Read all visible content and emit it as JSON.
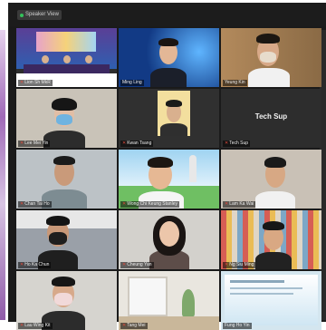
{
  "top_bar": {
    "view_label": "Speaker View"
  },
  "participants": [
    {
      "name": "Lion Sh MkR",
      "bg": "#4a3d7a"
    },
    {
      "name": "Ming Ling",
      "bg": "#163a7a"
    },
    {
      "name": "Yeung Kin",
      "bg": "#8a6a45"
    },
    {
      "name": "Lee Mei Yin",
      "bg": "#c9c3b8"
    },
    {
      "name": "Kwan Tsang",
      "bg": "#303030"
    },
    {
      "name": "Tech Sup",
      "bg": "#2d2d2d"
    },
    {
      "name": "Chan Tai Ho",
      "bg": "#bcc2c6"
    },
    {
      "name": "Wong Chi Keung Stanley",
      "bg": "#6fbf63"
    },
    {
      "name": "Lam Ka Wai",
      "bg": "#c9c1b6"
    },
    {
      "name": "Ho Ka Chun",
      "bg": "#9aa0a8"
    },
    {
      "name": "Cheung Yan",
      "bg": "#d3d1cc"
    },
    {
      "name": "Ng Siu Ming",
      "bg": "#caa77c"
    },
    {
      "name": "Lau Wing Kit",
      "bg": "#d6d4cf"
    },
    {
      "name": "Tang Mei",
      "bg": "#e9e6df"
    },
    {
      "name": "Fung Ho Yin",
      "bg": "#d4e6ef"
    }
  ],
  "tech_support_label": "Tech Sup"
}
